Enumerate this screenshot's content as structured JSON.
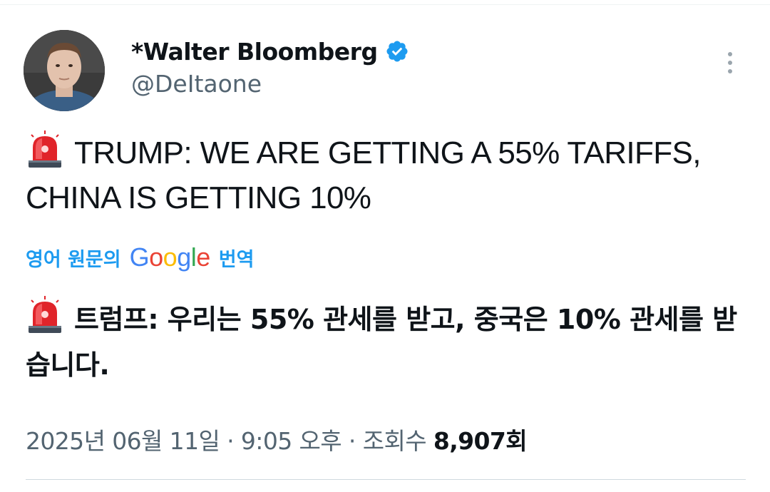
{
  "author": {
    "display_name": "*Walter Bloomberg",
    "handle": "@DeItaone",
    "verified": true
  },
  "tweet": {
    "emoji": "rotating-light-icon",
    "text": "TRUMP: WE ARE GETTING A 55% TARIFFS, CHINA IS GETTING 10%"
  },
  "translation": {
    "prefix": "영어 원문의",
    "google": [
      "G",
      "o",
      "o",
      "g",
      "l",
      "e"
    ],
    "suffix": "번역",
    "text": "트럼프: 우리는 55% 관세를 받고, 중국은 10% 관세를 받습니다."
  },
  "meta": {
    "date": "2025년 06월 11일",
    "separator_1": " · ",
    "time": "9:05 오후",
    "separator_2": " · ",
    "views_label": "조회수 ",
    "views_count": "8,907회"
  },
  "colors": {
    "accent": "#1d9bf0",
    "secondary_text": "#536471",
    "primary_text": "#0f1419",
    "google_blue": "#4285f4",
    "google_red": "#ea4335",
    "google_yellow": "#fbbc05",
    "google_green": "#34a853"
  }
}
